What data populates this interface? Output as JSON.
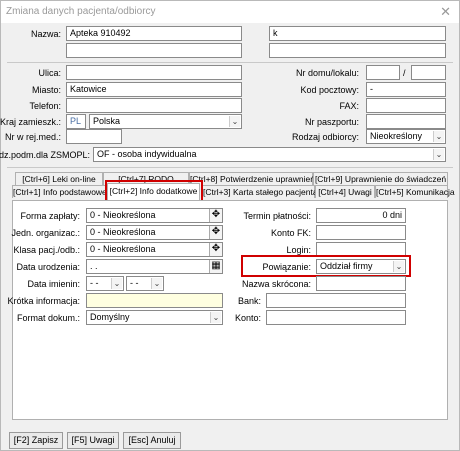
{
  "window": {
    "title": "Zmiana danych pacjenta/odbiorcy",
    "close_glyph": "✕"
  },
  "form": {
    "nazwa_label": "Nazwa:",
    "nazwa_value": "Apteka 910492",
    "nazwa_right_value": "k",
    "ulica_label": "Ulica:",
    "ulica_value": "",
    "nr_domu_label": "Nr domu/lokalu:",
    "slash": "/",
    "miasto_label": "Miasto:",
    "miasto_value": "Katowice",
    "kod_label": "Kod pocztowy:",
    "kod_value": "-",
    "telefon_label": "Telefon:",
    "fax_label": "FAX:",
    "kraj_label": "Kraj zamieszk.:",
    "kraj_code": "PL",
    "kraj_value": "Polska",
    "nr_paszportu_label": "Nr paszportu:",
    "nr_rej_label": "Nr w rej.med.:",
    "rodzaj_label": "Rodzaj odbiorcy:",
    "rodzaj_value": "Nieokreślony",
    "rodz_podm_label": "Rodz.podm.dla ZSMOPL:",
    "rodz_podm_value": "OF - osoba indywidualna"
  },
  "tabs_row1": [
    "[Ctrl+6] Leki on-line",
    "[Ctrl+7] RODO",
    "[Ctrl+8] Potwierdzenie uprawnień",
    "[Ctrl+9] Uprawnienie do świadczeń"
  ],
  "tabs_row2": [
    "[Ctrl+1] Info podstawowe",
    "[Ctrl+2] Info dodatkowe",
    "[Ctrl+3] Karta stałego pacjenta",
    "[Ctrl+4] Uwagi",
    "[Ctrl+5] Komunikacja"
  ],
  "panel": {
    "forma_zaplaty_label": "Forma zapłaty:",
    "forma_zaplaty_value": "0 - Nieokreślona",
    "jedn_org_label": "Jedn. organizac.:",
    "jedn_org_value": "0 - Nieokreślona",
    "klasa_label": "Klasa pacj./odb.:",
    "klasa_value": "0 - Nieokreślona",
    "data_ur_label": "Data urodzenia:",
    "data_ur_value": ". .",
    "data_im_label": "Data imienin:",
    "data_im_day": "- -",
    "data_im_month": "- -",
    "krotka_label": "Krótka informacja:",
    "format_label": "Format dokum.:",
    "format_value": "Domyślny",
    "termin_label": "Termin płatności:",
    "termin_value": "0 dni",
    "konto_fk_label": "Konto FK:",
    "login_label": "Login:",
    "powiazanie_label": "Powiązanie:",
    "powiazanie_value": "Oddział firmy",
    "nazwa_skr_label": "Nazwa skrócona:",
    "bank_label": "Bank:",
    "konto_label": "Konto:"
  },
  "buttons": {
    "zapisz": "[F2] Zapisz",
    "uwagi": "[F5] Uwagi",
    "anuluj": "[Esc] Anuluj"
  },
  "icons": {
    "plus": "✥",
    "calendar": "▦",
    "dropdown": "⌄"
  },
  "colors": {
    "highlight": "#d00000",
    "yellow_field": "#ffffe0"
  }
}
